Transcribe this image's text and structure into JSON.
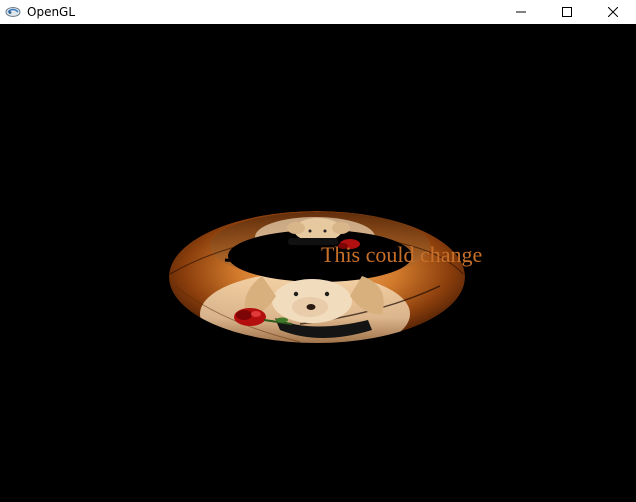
{
  "window": {
    "title": "OpenGL",
    "controls": {
      "minimize_icon": "minimize-icon",
      "maximize_icon": "maximize-icon",
      "close_icon": "close-icon"
    }
  },
  "scene": {
    "background_color": "#000000",
    "object": "textured torus with puppy and rose image",
    "overlay_text": "This could change",
    "overlay_text_color": "#c8702a"
  }
}
